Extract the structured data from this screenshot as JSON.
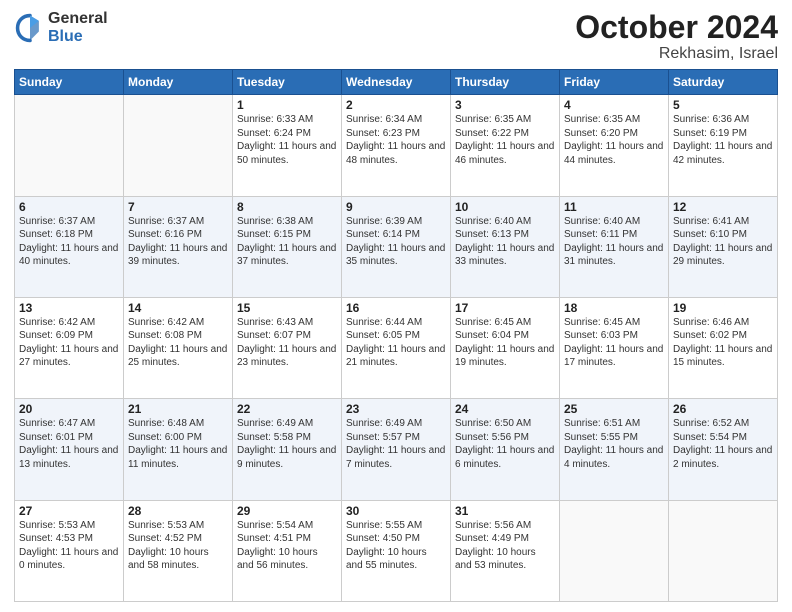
{
  "header": {
    "logo_general": "General",
    "logo_blue": "Blue",
    "month": "October 2024",
    "location": "Rekhasim, Israel"
  },
  "weekdays": [
    "Sunday",
    "Monday",
    "Tuesday",
    "Wednesday",
    "Thursday",
    "Friday",
    "Saturday"
  ],
  "weeks": [
    [
      {
        "day": "",
        "info": ""
      },
      {
        "day": "",
        "info": ""
      },
      {
        "day": "1",
        "info": "Sunrise: 6:33 AM\nSunset: 6:24 PM\nDaylight: 11 hours and 50 minutes."
      },
      {
        "day": "2",
        "info": "Sunrise: 6:34 AM\nSunset: 6:23 PM\nDaylight: 11 hours and 48 minutes."
      },
      {
        "day": "3",
        "info": "Sunrise: 6:35 AM\nSunset: 6:22 PM\nDaylight: 11 hours and 46 minutes."
      },
      {
        "day": "4",
        "info": "Sunrise: 6:35 AM\nSunset: 6:20 PM\nDaylight: 11 hours and 44 minutes."
      },
      {
        "day": "5",
        "info": "Sunrise: 6:36 AM\nSunset: 6:19 PM\nDaylight: 11 hours and 42 minutes."
      }
    ],
    [
      {
        "day": "6",
        "info": "Sunrise: 6:37 AM\nSunset: 6:18 PM\nDaylight: 11 hours and 40 minutes."
      },
      {
        "day": "7",
        "info": "Sunrise: 6:37 AM\nSunset: 6:16 PM\nDaylight: 11 hours and 39 minutes."
      },
      {
        "day": "8",
        "info": "Sunrise: 6:38 AM\nSunset: 6:15 PM\nDaylight: 11 hours and 37 minutes."
      },
      {
        "day": "9",
        "info": "Sunrise: 6:39 AM\nSunset: 6:14 PM\nDaylight: 11 hours and 35 minutes."
      },
      {
        "day": "10",
        "info": "Sunrise: 6:40 AM\nSunset: 6:13 PM\nDaylight: 11 hours and 33 minutes."
      },
      {
        "day": "11",
        "info": "Sunrise: 6:40 AM\nSunset: 6:11 PM\nDaylight: 11 hours and 31 minutes."
      },
      {
        "day": "12",
        "info": "Sunrise: 6:41 AM\nSunset: 6:10 PM\nDaylight: 11 hours and 29 minutes."
      }
    ],
    [
      {
        "day": "13",
        "info": "Sunrise: 6:42 AM\nSunset: 6:09 PM\nDaylight: 11 hours and 27 minutes."
      },
      {
        "day": "14",
        "info": "Sunrise: 6:42 AM\nSunset: 6:08 PM\nDaylight: 11 hours and 25 minutes."
      },
      {
        "day": "15",
        "info": "Sunrise: 6:43 AM\nSunset: 6:07 PM\nDaylight: 11 hours and 23 minutes."
      },
      {
        "day": "16",
        "info": "Sunrise: 6:44 AM\nSunset: 6:05 PM\nDaylight: 11 hours and 21 minutes."
      },
      {
        "day": "17",
        "info": "Sunrise: 6:45 AM\nSunset: 6:04 PM\nDaylight: 11 hours and 19 minutes."
      },
      {
        "day": "18",
        "info": "Sunrise: 6:45 AM\nSunset: 6:03 PM\nDaylight: 11 hours and 17 minutes."
      },
      {
        "day": "19",
        "info": "Sunrise: 6:46 AM\nSunset: 6:02 PM\nDaylight: 11 hours and 15 minutes."
      }
    ],
    [
      {
        "day": "20",
        "info": "Sunrise: 6:47 AM\nSunset: 6:01 PM\nDaylight: 11 hours and 13 minutes."
      },
      {
        "day": "21",
        "info": "Sunrise: 6:48 AM\nSunset: 6:00 PM\nDaylight: 11 hours and 11 minutes."
      },
      {
        "day": "22",
        "info": "Sunrise: 6:49 AM\nSunset: 5:58 PM\nDaylight: 11 hours and 9 minutes."
      },
      {
        "day": "23",
        "info": "Sunrise: 6:49 AM\nSunset: 5:57 PM\nDaylight: 11 hours and 7 minutes."
      },
      {
        "day": "24",
        "info": "Sunrise: 6:50 AM\nSunset: 5:56 PM\nDaylight: 11 hours and 6 minutes."
      },
      {
        "day": "25",
        "info": "Sunrise: 6:51 AM\nSunset: 5:55 PM\nDaylight: 11 hours and 4 minutes."
      },
      {
        "day": "26",
        "info": "Sunrise: 6:52 AM\nSunset: 5:54 PM\nDaylight: 11 hours and 2 minutes."
      }
    ],
    [
      {
        "day": "27",
        "info": "Sunrise: 5:53 AM\nSunset: 4:53 PM\nDaylight: 11 hours and 0 minutes."
      },
      {
        "day": "28",
        "info": "Sunrise: 5:53 AM\nSunset: 4:52 PM\nDaylight: 10 hours and 58 minutes."
      },
      {
        "day": "29",
        "info": "Sunrise: 5:54 AM\nSunset: 4:51 PM\nDaylight: 10 hours and 56 minutes."
      },
      {
        "day": "30",
        "info": "Sunrise: 5:55 AM\nSunset: 4:50 PM\nDaylight: 10 hours and 55 minutes."
      },
      {
        "day": "31",
        "info": "Sunrise: 5:56 AM\nSunset: 4:49 PM\nDaylight: 10 hours and 53 minutes."
      },
      {
        "day": "",
        "info": ""
      },
      {
        "day": "",
        "info": ""
      }
    ]
  ]
}
